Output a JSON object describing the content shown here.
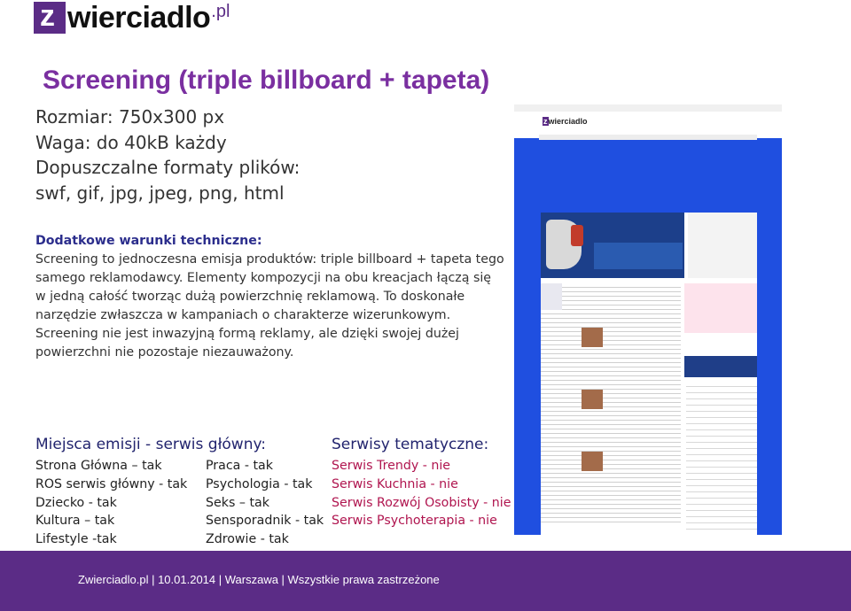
{
  "logo": {
    "letter": "z",
    "text": "wierciadlo",
    "tld": ".pl"
  },
  "title": "Screening (triple billboard + tapeta)",
  "specs": [
    "Rozmiar: 750x300 px",
    "Waga: do 40kB każdy",
    "Dopuszczalne formaty plików:",
    "swf, gif, jpg, jpeg, png, html"
  ],
  "extra": {
    "heading": "Dodatkowe warunki techniczne:",
    "body": "Screening to jednoczesna emisja produktów: triple billboard + tapeta tego samego reklamodawcy. Elementy kompozycji na obu kreacjach łączą się w jedną całość tworząc dużą powierzchnię reklamową. To doskonałe narzędzie zwłaszcza w kampaniach o charakterze wizerunkowym. Screening nie jest inwazyjną formą reklamy, ale dzięki swojej dużej powierzchni nie pozostaje niezauważony."
  },
  "main_service": {
    "heading": "Miejsca emisji - serwis główny:",
    "col1": [
      "Strona Główna – tak",
      "ROS serwis główny - tak",
      "Dziecko - tak",
      "Kultura – tak",
      "Lifestyle -tak"
    ],
    "col2": [
      "Praca - tak",
      "Psychologia - tak",
      "Seks – tak",
      "Sensporadnik - tak",
      "Zdrowie - tak"
    ]
  },
  "thematic": {
    "heading": "Serwisy tematyczne:",
    "items": [
      "Serwis Trendy - nie",
      "Serwis Kuchnia - nie",
      "Serwis Rozwój Osobisty - nie",
      "Serwis Psychoterapia - nie"
    ]
  },
  "colors": {
    "brand": "#5b2c86",
    "title": "#7a2fa0",
    "accent_pink": "#b0154f",
    "screen_bg": "#1f4fe0"
  },
  "footer": "Zwierciadlo.pl | 10.01.2014 | Warszawa | Wszystkie prawa zastrzeżone"
}
